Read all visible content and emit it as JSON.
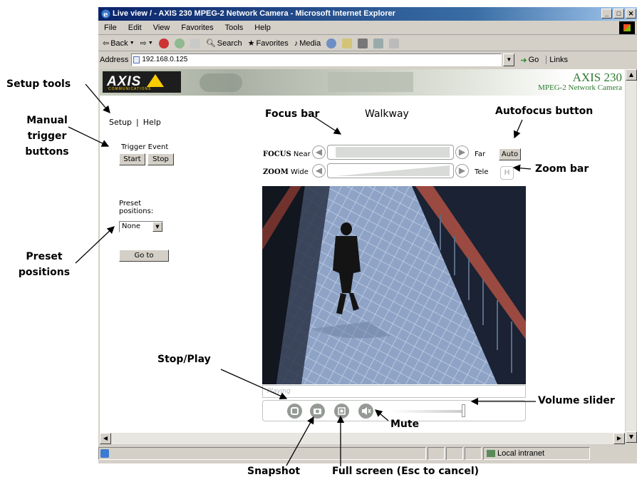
{
  "window": {
    "title": "Live view / - AXIS 230 MPEG-2 Network Camera - Microsoft Internet Explorer",
    "min": "_",
    "max": "□",
    "close": "✕"
  },
  "menu": [
    "File",
    "Edit",
    "View",
    "Favorites",
    "Tools",
    "Help"
  ],
  "toolbar": {
    "back": "Back",
    "search": "Search",
    "favorites": "Favorites",
    "media": "Media"
  },
  "address": {
    "label": "Address",
    "url": "192.168.0.125",
    "go": "Go",
    "links": "Links"
  },
  "status": {
    "zone": "Local intranet"
  },
  "banner": {
    "logo": "AXIS",
    "logo_sub": "COMMUNICATIONS",
    "product": "AXIS 230",
    "product_sub": "MPEG-2 Network Camera"
  },
  "nav": {
    "setup": "Setup",
    "separator": "|",
    "help": "Help"
  },
  "trigger": {
    "label": "Trigger Event",
    "start": "Start",
    "stop": "Stop"
  },
  "preset": {
    "label": "Preset positions:",
    "selected": "None",
    "goto": "Go to"
  },
  "camera": {
    "name": "Walkway",
    "focus_label": "FOCUS",
    "focus_near": "Near",
    "focus_far": "Far",
    "auto": "Auto",
    "zoom_label": "ZOOM",
    "zoom_wide": "Wide",
    "zoom_tele": "Tele",
    "hold": "H",
    "video_status": "Playing",
    "volume_level": 0.95
  },
  "annotations": {
    "setup_tools": "Setup tools",
    "manual_trigger": [
      "Manual",
      "trigger",
      "buttons"
    ],
    "preset_positions": [
      "Preset",
      "positions"
    ],
    "focus_bar": "Focus bar",
    "autofocus_button": "Autofocus button",
    "zoom_bar": "Zoom bar",
    "stop_play": "Stop/Play",
    "volume_slider": "Volume slider",
    "mute": "Mute",
    "snapshot": "Snapshot",
    "full_screen": "Full screen (Esc to cancel)"
  },
  "colors": {
    "title_bar": "#0a246a",
    "brand_green": "#2e7a2e",
    "axis_yellow": "#ffcc00"
  }
}
